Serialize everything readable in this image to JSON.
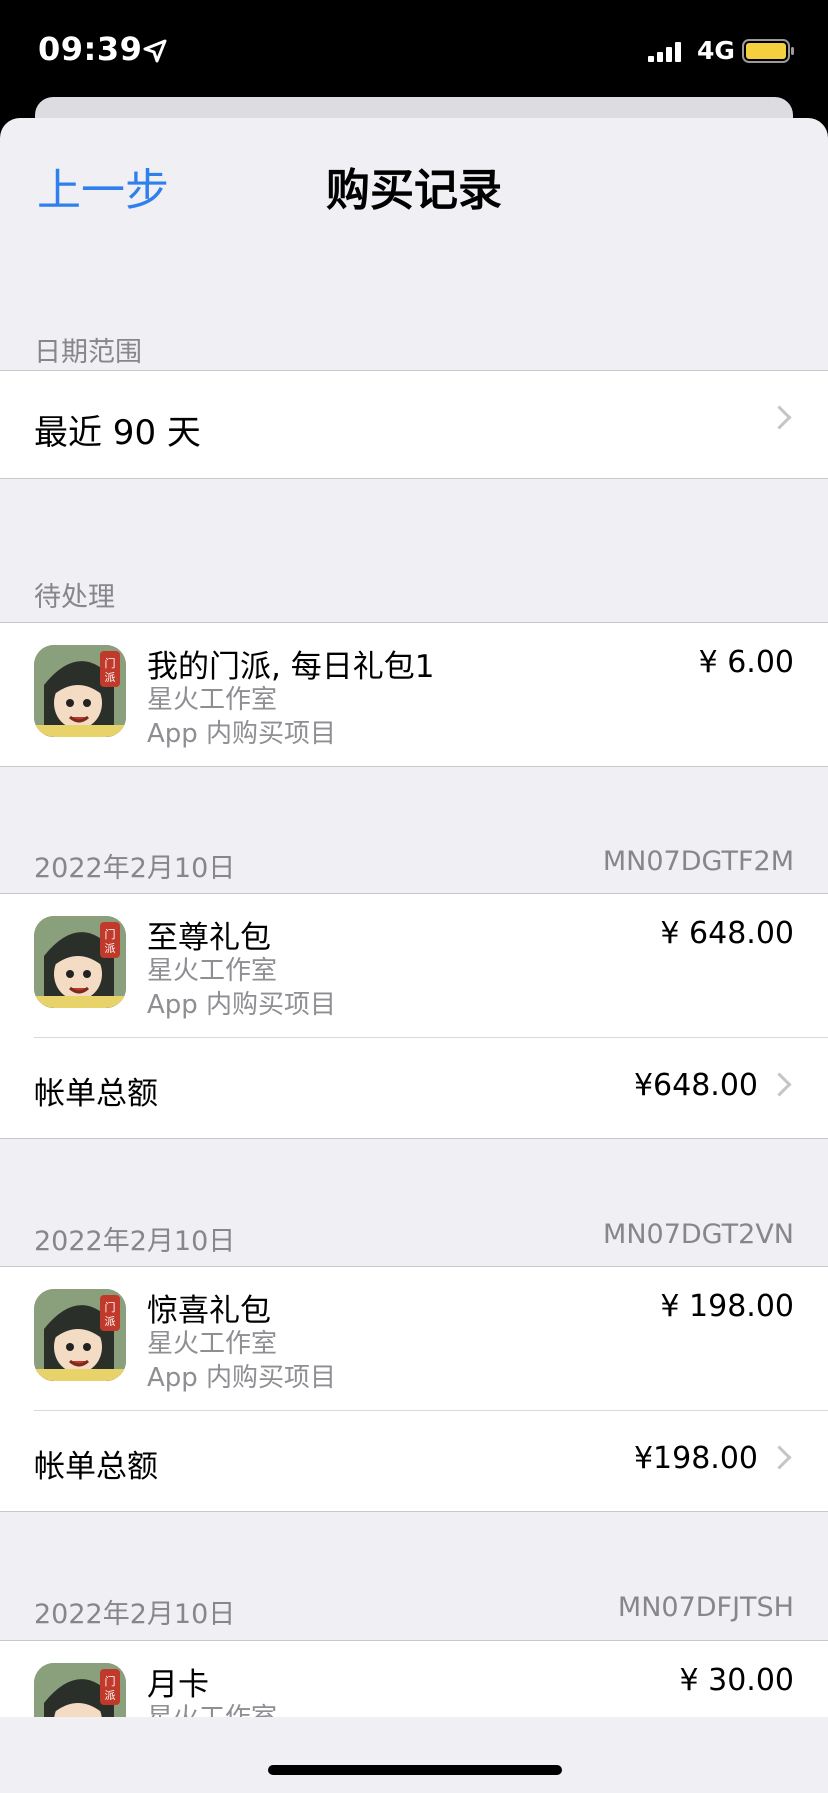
{
  "status": {
    "time": "09:39",
    "network": "4G"
  },
  "nav": {
    "back_label": "上一步",
    "title": "购买记录"
  },
  "date_range": {
    "header": "日期范围",
    "value": "最近 90 天"
  },
  "pending": {
    "header": "待处理",
    "item": {
      "name": "我的门派, 每日礼包1",
      "developer": "星火工作室",
      "kind": "App 内购买项目",
      "price": "¥ 6.00"
    }
  },
  "orders": [
    {
      "date": "2022年2月10日",
      "order_id": "MN07DGTF2M",
      "item": {
        "name": "至尊礼包",
        "developer": "星火工作室",
        "kind": "App 内购买项目",
        "price": "¥ 648.00"
      },
      "total_label": "帐单总额",
      "total": "¥648.00"
    },
    {
      "date": "2022年2月10日",
      "order_id": "MN07DGT2VN",
      "item": {
        "name": "惊喜礼包",
        "developer": "星火工作室",
        "kind": "App 内购买项目",
        "price": "¥ 198.00"
      },
      "total_label": "帐单总额",
      "total": "¥198.00"
    },
    {
      "date": "2022年2月10日",
      "order_id": "MN07DFJTSH",
      "item": {
        "name": "月卡",
        "developer": "星火工作室",
        "price": "¥ 30.00"
      }
    }
  ],
  "icons": {
    "location": "location-arrow-icon",
    "signal": "cellular-signal-icon",
    "battery": "battery-icon",
    "chevron": "chevron-right-icon",
    "app": "app-icon-menpai"
  },
  "colors": {
    "accent": "#2f80ed",
    "background": "#efeff4",
    "battery": "#f4d03f"
  }
}
